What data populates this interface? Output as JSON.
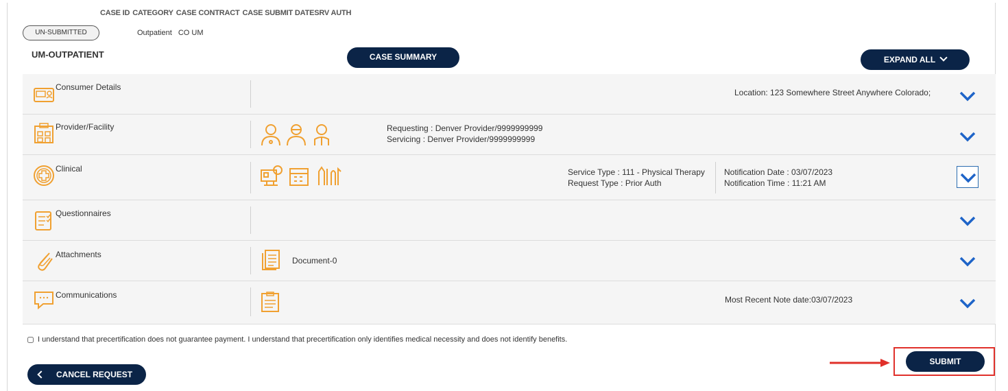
{
  "header": {
    "columns": [
      "CASE ID",
      "CATEGORY",
      "CASE CONTRACT",
      "CASE SUBMIT DATE",
      "SRV AUTH"
    ],
    "status": "UN-SUBMITTED",
    "category": "Outpatient",
    "contract": "CO UM"
  },
  "section": {
    "title": "UM-OUTPATIENT",
    "summary_button": "CASE SUMMARY",
    "expand_button": "EXPAND ALL"
  },
  "rows": {
    "consumer": {
      "label": "Consumer Details",
      "location": "Location: 123 Somewhere Street Anywhere Colorado;"
    },
    "provider": {
      "label": "Provider/Facility",
      "requesting": "Requesting : Denver Provider/9999999999",
      "servicing": "Servicing : Denver Provider/9999999999"
    },
    "clinical": {
      "label": "Clinical",
      "service_type": "Service Type : 111 - Physical Therapy",
      "request_type": "Request Type : Prior Auth",
      "notification_date": "Notification Date : 03/07/2023",
      "notification_time": "Notification Time : 11:21 AM"
    },
    "questionnaires": {
      "label": "Questionnaires"
    },
    "attachments": {
      "label": "Attachments",
      "document": "Document-0"
    },
    "communications": {
      "label": "Communications",
      "recent_note": "Most Recent Note date:03/07/2023"
    }
  },
  "agreement": "I understand that precertification does not guarantee payment. I understand that precertification only identifies medical necessity and does not identify benefits.",
  "actions": {
    "cancel": "CANCEL REQUEST",
    "submit": "SUBMIT"
  },
  "colors": {
    "navy": "#0b2447",
    "accent": "#f0a030",
    "chevron": "#1e64c8",
    "highlight": "#e0302a"
  }
}
